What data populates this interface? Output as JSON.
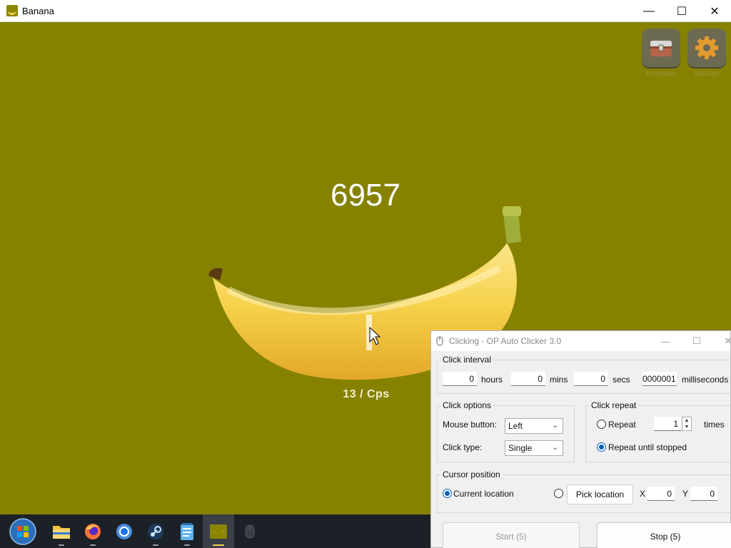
{
  "window": {
    "title": "Banana",
    "controls": {
      "minimize": "—",
      "maximize": "☐",
      "close": "✕"
    }
  },
  "game": {
    "count": "6957",
    "cps": "13 / Cps",
    "inventory_label": "Inventory",
    "settings_label": "Settings"
  },
  "taskbar": {
    "items": [
      "start-orb",
      "file-explorer",
      "firefox",
      "chrome",
      "steam",
      "notepad",
      "banana",
      "mouse-app"
    ]
  },
  "clicker": {
    "title": "Clicking - OP Auto Clicker 3.0",
    "interval": {
      "label": "Click interval",
      "hours": "0",
      "hours_label": "hours",
      "mins": "0",
      "mins_label": "mins",
      "secs": "0",
      "secs_label": "secs",
      "ms": "0000001",
      "ms_label": "milliseconds"
    },
    "options": {
      "label": "Click options",
      "mouse_button_label": "Mouse button:",
      "mouse_button": "Left",
      "click_type_label": "Click type:",
      "click_type": "Single"
    },
    "repeat": {
      "label": "Click repeat",
      "repeat_label": "Repeat",
      "repeat_count": "1",
      "times_label": "times",
      "until_stopped_label": "Repeat until stopped",
      "selected": "until_stopped"
    },
    "cursor": {
      "label": "Cursor position",
      "current_label": "Current location",
      "pick_label": "Pick location",
      "x_label": "X",
      "x": "0",
      "y_label": "Y",
      "y": "0",
      "selected": "current"
    },
    "start_label": "Start (5)",
    "stop_label": "Stop (5)"
  }
}
